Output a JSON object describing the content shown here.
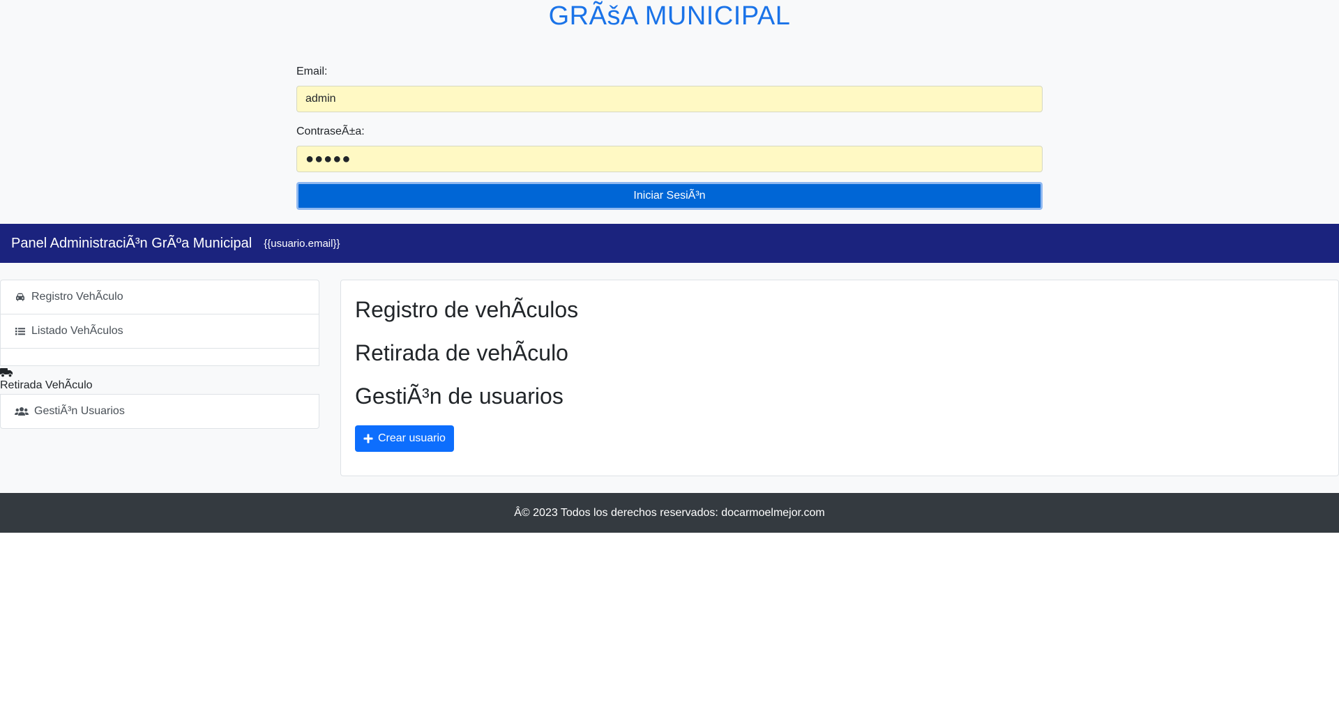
{
  "login": {
    "app_title": "GRÃšA MUNICIPAL",
    "email_label": "Email:",
    "email_value": "admin",
    "password_label": "ContraseÃ±a:",
    "password_value": "●●●●●",
    "submit_label": "Iniciar SesiÃ³n"
  },
  "navbar": {
    "brand": "Panel AdministraciÃ³n GrÃºa Municipal",
    "user_email": "{{usuario.email}}",
    "background": "#1b237e"
  },
  "sidebar": {
    "items": [
      {
        "label": "Registro VehÃculo",
        "icon": "car-icon"
      },
      {
        "label": "Listado VehÃculos",
        "icon": "list-icon"
      },
      {
        "label": "Retirada VehÃculo",
        "icon": "truck-icon"
      },
      {
        "label": "GestiÃ³n Usuarios",
        "icon": "users-icon"
      }
    ]
  },
  "content": {
    "headings": [
      "Registro de vehÃculos",
      "Retirada de vehÃculo",
      "GestiÃ³n de usuarios"
    ],
    "create_user_label": "Crear usuario",
    "create_user_icon": "plus-icon",
    "accent": "#0d6efd"
  },
  "footer": {
    "text": "Â© 2023 Todos los derechos reservados: docarmoelmejor.com",
    "background": "#343a40"
  }
}
